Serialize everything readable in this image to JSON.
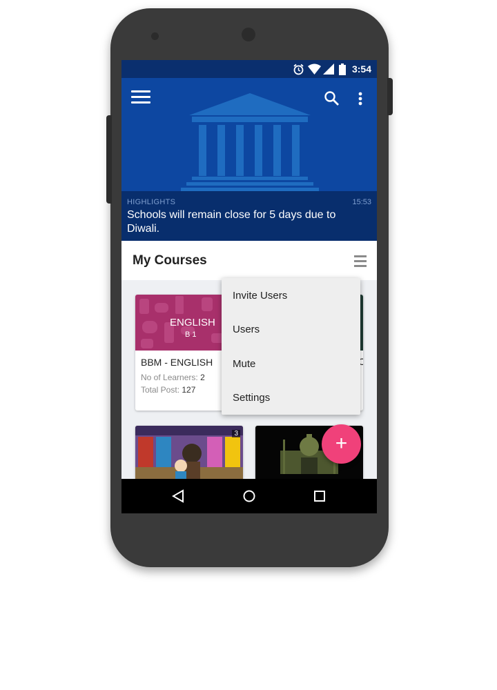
{
  "status_bar": {
    "time": "3:54",
    "icons": [
      "alarm-icon",
      "wifi-icon",
      "cell-signal-icon",
      "battery-icon"
    ]
  },
  "header": {
    "icons": [
      "menu-icon",
      "search-icon",
      "more-vert-icon"
    ],
    "highlight": {
      "label": "HIGHLIGHTS",
      "time": "15:53",
      "text": "Schools will remain close for 5 days due to Diwali."
    }
  },
  "courses": {
    "title": "My Courses",
    "cards": [
      {
        "cover_text": "ENGLISH",
        "cover_sub": "B 1",
        "title": "BBM - ENGLISH",
        "learners_label": "No of Learners:",
        "learners_value": "2",
        "posts_label": "Total Post:",
        "posts_value": "127"
      },
      {
        "badge": "3"
      }
    ]
  },
  "popup_menu": {
    "items": [
      "Invite Users",
      "Users",
      "Mute",
      "Settings"
    ]
  },
  "fab": {
    "label": "+"
  },
  "nav_bar": {
    "icons": [
      "back-icon",
      "home-icon",
      "recents-icon"
    ]
  },
  "colors": {
    "primary_dark": "#0a2f6e",
    "primary": "#0d47a1",
    "accent": "#f0417a",
    "phone_body": "#3a3a3a"
  }
}
